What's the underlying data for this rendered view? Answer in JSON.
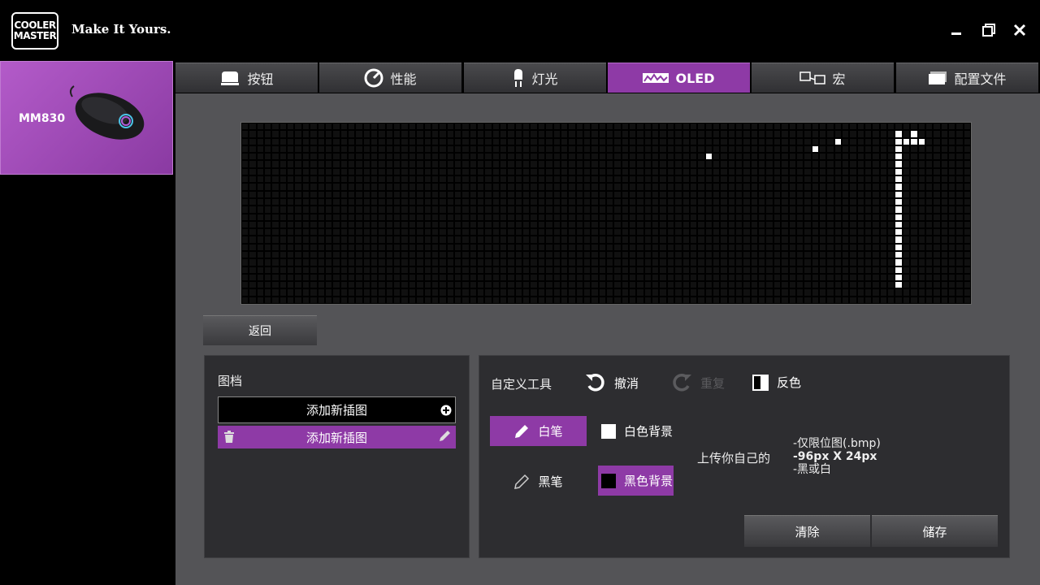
{
  "header": {
    "logo_line1": "COOLER",
    "logo_line2": "MASTER",
    "slogan": "Make It Yours.",
    "window_controls": [
      "minimize-icon",
      "restore-icon",
      "close-icon"
    ]
  },
  "device": {
    "name": "MM830"
  },
  "tabs": [
    {
      "label": "按钮",
      "icon": "button-icon"
    },
    {
      "label": "性能",
      "icon": "performance-icon"
    },
    {
      "label": "灯光",
      "icon": "light-icon"
    },
    {
      "label": "OLED",
      "icon": "oled-icon",
      "active": true
    },
    {
      "label": "宏",
      "icon": "macro-icon"
    },
    {
      "label": "配置文件",
      "icon": "profile-icon"
    }
  ],
  "oled": {
    "columns": 96,
    "rows": 24,
    "pixels": [
      "000000000000000000000000000000000000000000000000000000000000000000000000000000000000000000000000",
      "000000000000000000000000000000000000000000000000000000000000000000000000000000000000001010000000",
      "000000000000000000000000000000000000000000000000000000000000000000000000000000100000001111000000",
      "000000000000000000000000000000000000000000000000000000000000000000000000000100000000001000000000",
      "000000000000000000000000000000000000000000000000000000000000010000000000000000000000001000000000",
      "000000000000000000000000000000000000000000000000000000000000000000000000000000000000001000000000",
      "000000000000000000000000000000000000000000000000000000000000000000000000000000000000001000000000",
      "000000000000000000000000000000000000000000000000000000000000000000000000000000000000001000000000",
      "000000000000000000000000000000000000000000000000000000000000000000000000000000000000001000000000",
      "000000000000000000000000000000000000000000000000000000000000000000000000000000000000001000000000",
      "000000000000000000000000000000000000000000000000000000000000000000000000000000000000001000000000",
      "000000000000000000000000000000000000000000000000000000000000000000000000000000000000001000000000",
      "000000000000000000000000000000000000000000000000000000000000000000000000000000000000001000000000",
      "000000000000000000000000000000000000000000000000000000000000000000000000000000000000001000000000",
      "000000000000000000000000000000000000000000000000000000000000000000000000000000000000001000000000",
      "000000000000000000000000000000000000000000000000000000000000000000000000000000000000001000000000",
      "000000000000000000000000000000000000000000000000000000000000000000000000000000000000001000000000",
      "000000000000000000000000000000000000000000000000000000000000000000000000000000000000001000000000",
      "000000000000000000000000000000000000000000000000000000000000000000000000000000000000001000000000",
      "000000000000000000000000000000000000000000000000000000000000000000000000000000000000001000000000",
      "000000000000000000000000000000000000000000000000000000000000000000000000000000000000001000000000",
      "000000000000000000000000000000000000000000000000000000000000000000000000000000000000001000000000",
      "000000000000000000000000000000000000000000000000000000000000000000000000000000000000000000000000",
      "000000000000000000000000000000000000000000000000000000000000000000000000000000000000000000000000"
    ]
  },
  "back_button": "返回",
  "file_panel": {
    "title": "图档",
    "add_label": "添加新插图",
    "item_label": "添加新插图"
  },
  "tools_panel": {
    "title": "自定义工具",
    "undo": "撤消",
    "redo": "重复",
    "invert": "反色",
    "white_pen": "白笔",
    "black_pen": "黑笔",
    "white_bg": "白色背景",
    "black_bg": "黑色背景",
    "upload_label": "上传你自己的",
    "upload_notes": [
      "-仅限位图(.bmp)",
      "-96px X 24px",
      "-黑或白"
    ],
    "clear": "清除",
    "save": "储存"
  }
}
